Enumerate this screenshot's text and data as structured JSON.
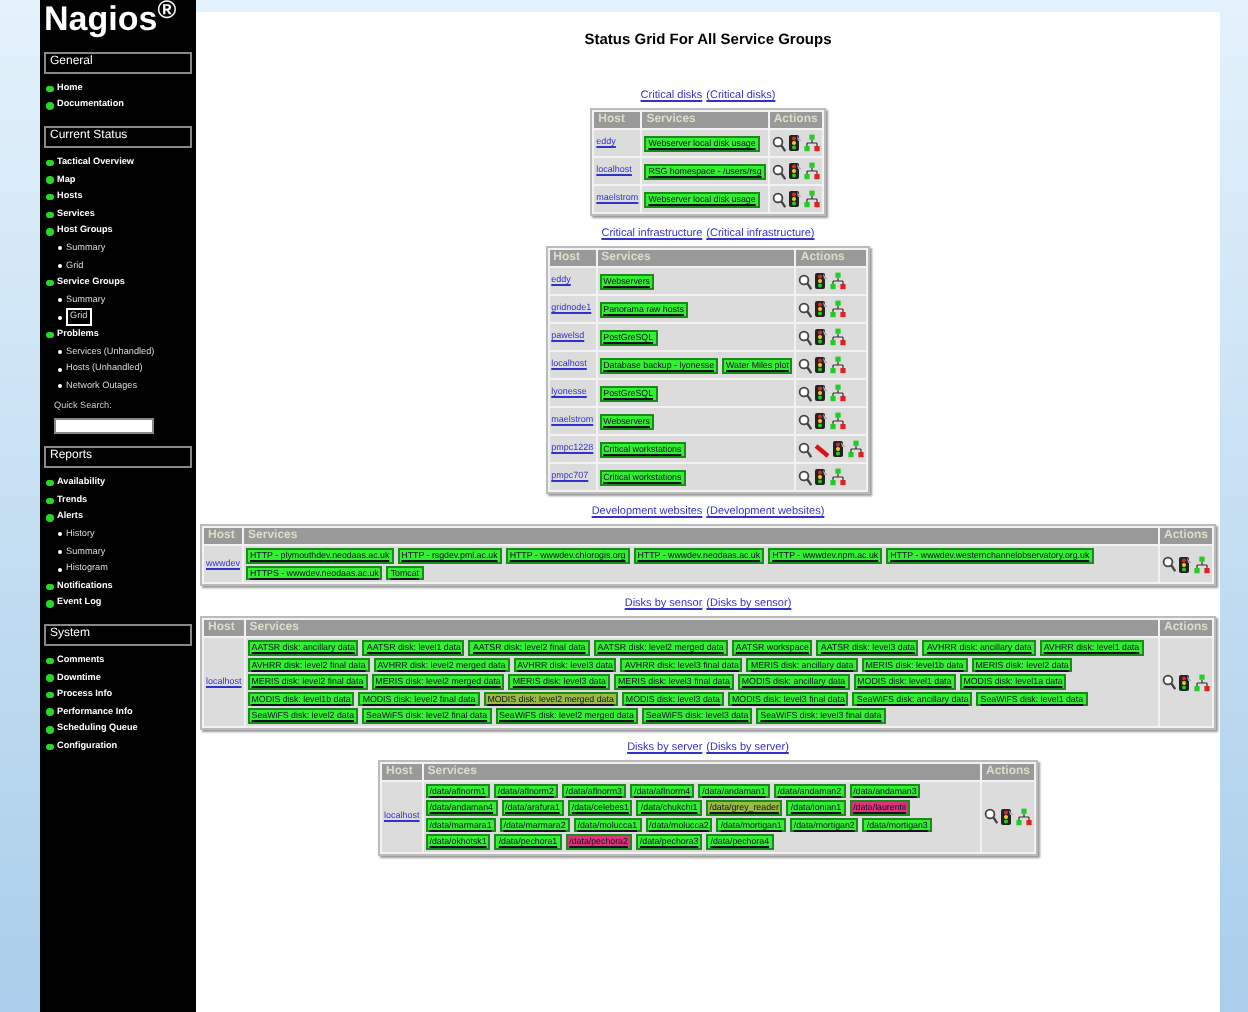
{
  "logo": "Nagios$^{®}$",
  "sidebar": {
    "sections": [
      {
        "title": "General",
        "items": [
          {
            "label": "Home",
            "selected": false
          },
          {
            "label": "Documentation",
            "selected": false
          }
        ]
      },
      {
        "title": "Current Status",
        "items": [
          {
            "label": "Tactical Overview",
            "selected": false
          },
          {
            "label": "Map",
            "selected": false
          },
          {
            "label": "Hosts",
            "selected": false
          },
          {
            "label": "Services",
            "selected": false
          },
          {
            "label": "Host Groups",
            "selected": false,
            "children": [
              {
                "label": "Summary",
                "selected": false
              },
              {
                "label": "Grid",
                "selected": false
              }
            ]
          },
          {
            "label": "Service Groups",
            "selected": false,
            "children": [
              {
                "label": "Summary",
                "selected": false
              },
              {
                "label": "Grid",
                "selected": true
              }
            ]
          },
          {
            "label": "Problems",
            "selected": false,
            "children": [
              {
                "label": "Services (Unhandled)",
                "selected": false
              },
              {
                "label": "Hosts (Unhandled)",
                "selected": false
              },
              {
                "label": "Network Outages",
                "selected": false
              }
            ]
          }
        ],
        "quick_search": {
          "label": "Quick Search:"
        }
      },
      {
        "title": "Reports",
        "items": [
          {
            "label": "Availability",
            "selected": false
          },
          {
            "label": "Trends",
            "selected": false
          },
          {
            "label": "Alerts",
            "selected": false,
            "children": [
              {
                "label": "History",
                "selected": false
              },
              {
                "label": "Summary",
                "selected": false
              },
              {
                "label": "Histogram",
                "selected": false
              }
            ]
          },
          {
            "label": "Notifications",
            "selected": false
          },
          {
            "label": "Event Log",
            "selected": false
          }
        ]
      },
      {
        "title": "System",
        "items": [
          {
            "label": "Comments",
            "selected": false
          },
          {
            "label": "Downtime",
            "selected": false
          },
          {
            "label": "Process Info",
            "selected": false
          },
          {
            "label": "Performance Info",
            "selected": false
          },
          {
            "label": "Scheduling Queue",
            "selected": false
          },
          {
            "label": "Configuration",
            "selected": false
          }
        ]
      }
    ]
  },
  "page_title": "Status Grid For All Service Groups",
  "groups": [
    {
      "name": "Critical disks",
      "alias": "(Critical disks)",
      "kind": "compact",
      "columns": [
        "Host",
        "Services",
        "Actions"
      ],
      "rows": [
        {
          "host": "eddy",
          "notifications_disabled": false,
          "services": [
            {
              "name": "Webserver local disk usage",
              "color": "#33ee33"
            }
          ]
        },
        {
          "host": "localhost",
          "notifications_disabled": false,
          "services": [
            {
              "name": "RSG homespace - /users/rsg",
              "color": "#33ee33"
            }
          ]
        },
        {
          "host": "maelstrom",
          "notifications_disabled": false,
          "services": [
            {
              "name": "Webserver local disk usage",
              "color": "#33ee33"
            }
          ]
        }
      ]
    },
    {
      "name": "Critical infrastructure",
      "alias": "(Critical infrastructure)",
      "kind": "compact",
      "columns": [
        "Host",
        "Services",
        "Actions"
      ],
      "rows": [
        {
          "host": "eddy",
          "notifications_disabled": false,
          "services": [
            {
              "name": "Webservers",
              "color": "#33ee33"
            }
          ]
        },
        {
          "host": "gridnode1",
          "notifications_disabled": false,
          "services": [
            {
              "name": "Panorama raw hosts",
              "color": "#33ee33"
            }
          ]
        },
        {
          "host": "pawelsd",
          "notifications_disabled": false,
          "services": [
            {
              "name": "PostGreSQL",
              "color": "#33ee33"
            }
          ]
        },
        {
          "host": "localhost",
          "notifications_disabled": false,
          "services": [
            {
              "name": "Database backup - lyonesse",
              "color": "#33ee33"
            },
            {
              "name": "Water Miles plot",
              "color": "#33ee33"
            }
          ]
        },
        {
          "host": "lyonesse",
          "notifications_disabled": false,
          "services": [
            {
              "name": "PostGreSQL",
              "color": "#33ee33"
            }
          ]
        },
        {
          "host": "maelstrom",
          "notifications_disabled": false,
          "services": [
            {
              "name": "Webservers",
              "color": "#33ee33"
            }
          ]
        },
        {
          "host": "pmpc1228",
          "notifications_disabled": true,
          "services": [
            {
              "name": "Critical workstations",
              "color": "#33ee33"
            }
          ]
        },
        {
          "host": "pmpc707",
          "notifications_disabled": false,
          "services": [
            {
              "name": "Critical workstations",
              "color": "#33ee33"
            }
          ]
        }
      ]
    },
    {
      "name": "Development websites",
      "alias": "(Development websites)",
      "kind": "full",
      "columns": [
        "Host",
        "Services",
        "Actions"
      ],
      "rows": [
        {
          "host": "wwwdev",
          "notifications_disabled": false,
          "services": [
            {
              "name": "HTTP - plymouthdev.neodaas.ac.uk",
              "color": "#33ee33"
            },
            {
              "name": "HTTP - rsgdev.pml.ac.uk",
              "color": "#33ee33"
            },
            {
              "name": "HTTP - wwwdev.chlorogis.org",
              "color": "#33ee33"
            },
            {
              "name": "HTTP - wwwdev.neodaas.ac.uk",
              "color": "#33ee33"
            },
            {
              "name": "HTTP - wwwdev.npm.ac.uk",
              "color": "#33ee33"
            },
            {
              "name": "HTTP - wwwdev.westernchannelobservatory.org.uk",
              "color": "#33ee33"
            },
            {
              "name": "HTTPS - wwwdev.neodaas.ac.uk",
              "color": "#33ee33"
            },
            {
              "name": "Tomcat",
              "color": "#33ee33"
            }
          ]
        }
      ]
    },
    {
      "name": "Disks by sensor",
      "alias": "(Disks by sensor)",
      "kind": "full",
      "columns": [
        "Host",
        "Services",
        "Actions"
      ],
      "rows": [
        {
          "host": "localhost",
          "notifications_disabled": false,
          "services": [
            {
              "name": "AATSR disk: ancillary data",
              "color": "#33ee33"
            },
            {
              "name": "AATSR disk: level1 data",
              "color": "#33ee33"
            },
            {
              "name": "AATSR disk: level2 final data",
              "color": "#33ee33"
            },
            {
              "name": "AATSR disk: level2 merged data",
              "color": "#33ee33"
            },
            {
              "name": "AATSR workspace",
              "color": "#33ee33"
            },
            {
              "name": "AATSR disk: level3 data",
              "color": "#33ee33"
            },
            {
              "name": "AVHRR disk: ancillary data",
              "color": "#33ee33"
            },
            {
              "name": "AVHRR disk: level1 data",
              "color": "#33ee33"
            },
            {
              "name": "AVHRR disk: level2 final data",
              "color": "#33ee33"
            },
            {
              "name": "AVHRR disk: level2 merged data",
              "color": "#33ee33"
            },
            {
              "name": "AVHRR disk: level3 data",
              "color": "#33ee33"
            },
            {
              "name": "AVHRR disk: level3 final data",
              "color": "#33ee33"
            },
            {
              "name": "MERIS disk: ancillary data",
              "color": "#33ee33"
            },
            {
              "name": "MERIS disk: level1b data",
              "color": "#33ee33"
            },
            {
              "name": "MERIS disk: level2 data",
              "color": "#33ee33"
            },
            {
              "name": "MERIS disk: level2 final data",
              "color": "#33ee33"
            },
            {
              "name": "MERIS disk: level2 merged data",
              "color": "#33ee33"
            },
            {
              "name": "MERIS disk: level3 data",
              "color": "#33ee33"
            },
            {
              "name": "MERIS disk: level3 final data",
              "color": "#33ee33"
            },
            {
              "name": "MODIS disk: ancillary data",
              "color": "#33ee33"
            },
            {
              "name": "MODIS disk: level1 data",
              "color": "#33ee33"
            },
            {
              "name": "MODIS disk: level1a data",
              "color": "#33ee33"
            },
            {
              "name": "MODIS disk: level1b data",
              "color": "#33ee33"
            },
            {
              "name": "MODIS disk: level2 final data",
              "color": "#33ee33"
            },
            {
              "name": "MODIS disk: level2 merged data",
              "color": "#99bb44"
            },
            {
              "name": "MODIS disk: level3 data",
              "color": "#33ee33"
            },
            {
              "name": "MODIS disk: level3 final data",
              "color": "#33ee33"
            },
            {
              "name": "SeaWiFS disk: ancillary data",
              "color": "#33ee33"
            },
            {
              "name": "SeaWiFS disk: level1 data",
              "color": "#33ee33"
            },
            {
              "name": "SeaWiFS disk: level2 data",
              "color": "#33ee33"
            },
            {
              "name": "SeaWiFS disk: level2 final data",
              "color": "#33ee33"
            },
            {
              "name": "SeaWiFS disk: level2 merged data",
              "color": "#33ee33"
            },
            {
              "name": "SeaWiFS disk: level3 data",
              "color": "#33ee33"
            },
            {
              "name": "SeaWiFS disk: level3 final data",
              "color": "#33ee33"
            }
          ]
        }
      ]
    },
    {
      "name": "Disks by server",
      "alias": "(Disks by server)",
      "kind": "medium",
      "columns": [
        "Host",
        "Services",
        "Actions"
      ],
      "rows": [
        {
          "host": "localhost",
          "notifications_disabled": false,
          "services": [
            {
              "name": "/data/aflnorm1",
              "color": "#33ee33"
            },
            {
              "name": "/data/aflnorm2",
              "color": "#33ee33"
            },
            {
              "name": "/data/aflnorm3",
              "color": "#33ee33"
            },
            {
              "name": "/data/aflnorm4",
              "color": "#33ee33"
            },
            {
              "name": "/data/andaman1",
              "color": "#33ee33"
            },
            {
              "name": "/data/andaman2",
              "color": "#33ee33"
            },
            {
              "name": "/data/andaman3",
              "color": "#33ee33"
            },
            {
              "name": "/data/andaman4",
              "color": "#33ee33"
            },
            {
              "name": "/data/arafura1",
              "color": "#33ee33"
            },
            {
              "name": "/data/celebes1",
              "color": "#33ee33"
            },
            {
              "name": "/data/chukchi1",
              "color": "#33ee33"
            },
            {
              "name": "/data/grey_reader",
              "color": "#99bb44"
            },
            {
              "name": "/data/ionian1",
              "color": "#33ee33"
            },
            {
              "name": "/data/laurentii",
              "color": "#dd3377"
            },
            {
              "name": "/data/marmara1",
              "color": "#33ee33"
            },
            {
              "name": "/data/marmara2",
              "color": "#33ee33"
            },
            {
              "name": "/data/molucca1",
              "color": "#33ee33"
            },
            {
              "name": "/data/molucca2",
              "color": "#33ee33"
            },
            {
              "name": "/data/mortigan1",
              "color": "#33ee33"
            },
            {
              "name": "/data/mortigan2",
              "color": "#33ee33"
            },
            {
              "name": "/data/mortigan3",
              "color": "#33ee33"
            },
            {
              "name": "/data/okhotsk1",
              "color": "#33ee33"
            },
            {
              "name": "/data/pechora1",
              "color": "#33ee33"
            },
            {
              "name": "/data/pechora2",
              "color": "#dd3377"
            },
            {
              "name": "/data/pechora3",
              "color": "#33ee33"
            },
            {
              "name": "/data/pechora4",
              "color": "#33ee33"
            }
          ]
        }
      ]
    }
  ]
}
